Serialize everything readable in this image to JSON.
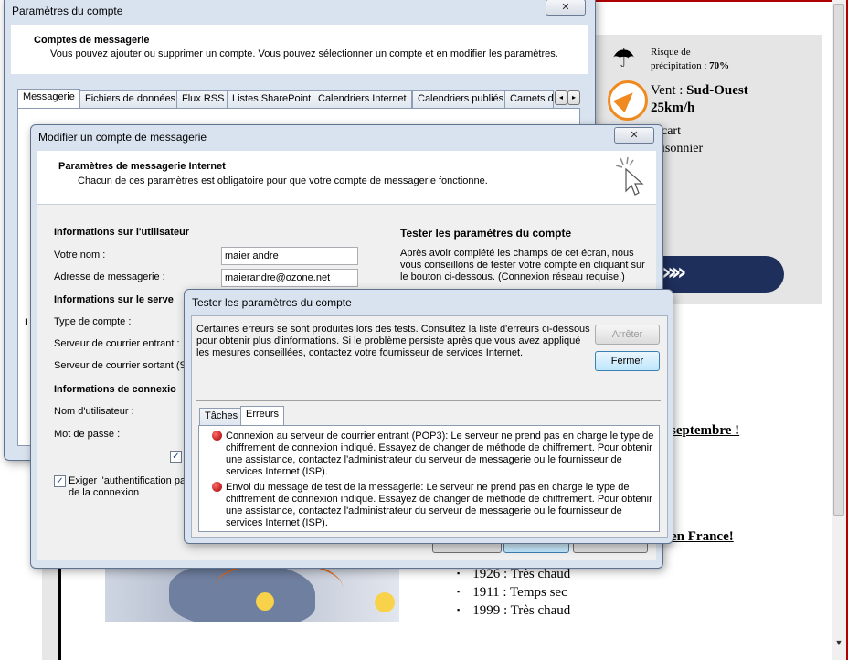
{
  "background_page": {
    "rain_risk_label": "Risque de\nprécipitation : ",
    "rain_risk_value": "70%",
    "wind_label": "Vent : ",
    "wind_dir": "Sud-Ouest",
    "wind_speed": "25km/h",
    "fragment_1": "cart",
    "fragment_2": "isonnier",
    "link_september": "septembre !",
    "link_france": "en France!",
    "history": [
      "1926 : Très chaud",
      "1911 : Temps sec",
      "1999 : Très chaud"
    ]
  },
  "account_settings": {
    "title": "Paramètres du compte",
    "close_label": "✕",
    "heading": "Comptes de messagerie",
    "description": "Vous pouvez ajouter ou supprimer un compte. Vous pouvez sélectionner un compte et en modifier les paramètres.",
    "tabs": [
      "Messagerie",
      "Fichiers de données",
      "Flux RSS",
      "Listes SharePoint",
      "Calendriers Internet",
      "Calendriers publiés",
      "Carnets d"
    ],
    "partial_left_label": "L"
  },
  "modify_account": {
    "title": "Modifier un compte de messagerie",
    "close_label": "✕",
    "heading": "Paramètres de messagerie Internet",
    "subheading": "Chacun de ces paramètres est obligatoire pour que votre compte de messagerie fonctionne.",
    "user_info_heading": "Informations sur l'utilisateur",
    "name_label": "Votre nom :",
    "name_value": "maier andre",
    "email_label": "Adresse de messagerie :",
    "email_value": "maierandre@ozone.net",
    "server_info_heading": "Informations sur le serve",
    "account_type_label": "Type de compte :",
    "incoming_label": "Serveur de courrier entrant :",
    "outgoing_label": "Serveur de courrier sortant (S",
    "login_info_heading": "Informations de connexio",
    "username_label": "Nom d'utilisateur :",
    "password_label": "Mot de passe :",
    "spa_label": "Exiger l'authentification pa\nde la connexion",
    "test_heading": "Tester les paramètres du compte",
    "test_description": "Après avoir complété les champs de cet écran, nous\nvous conseillons de tester votre compte en cliquant sur\nle bouton ci-dessous. (Connexion réseau requise.)"
  },
  "test_dialog": {
    "title": "Tester les paramètres du compte",
    "message": "Certaines erreurs se sont produites lors des tests. Consultez la liste d'erreurs ci-dessous\npour obtenir plus d'informations. Si le problème persiste après que vous avez appliqué\nles mesures conseillées, contactez votre fournisseur de services Internet.",
    "stop_label": "Arrêter",
    "close_label": "Fermer",
    "tab_tasks": "Tâches",
    "tab_errors": "Erreurs",
    "errors": [
      "Connexion au serveur de courrier entrant (POP3): Le serveur ne prend pas en charge le type de\nchiffrement de connexion indiqué. Essayez de changer de méthode de chiffrement. Pour obtenir\nune assistance, contactez l'administrateur du serveur de messagerie ou le fournisseur de\nservices Internet (ISP).",
      "Envoi du message de test de la messagerie: Le serveur ne prend pas en charge le type de\nchiffrement de connexion indiqué. Essayez de changer de méthode de chiffrement. Pour obtenir\nune assistance, contactez l'administrateur du serveur de messagerie ou le fournisseur de\nservices Internet (ISP)."
    ]
  }
}
